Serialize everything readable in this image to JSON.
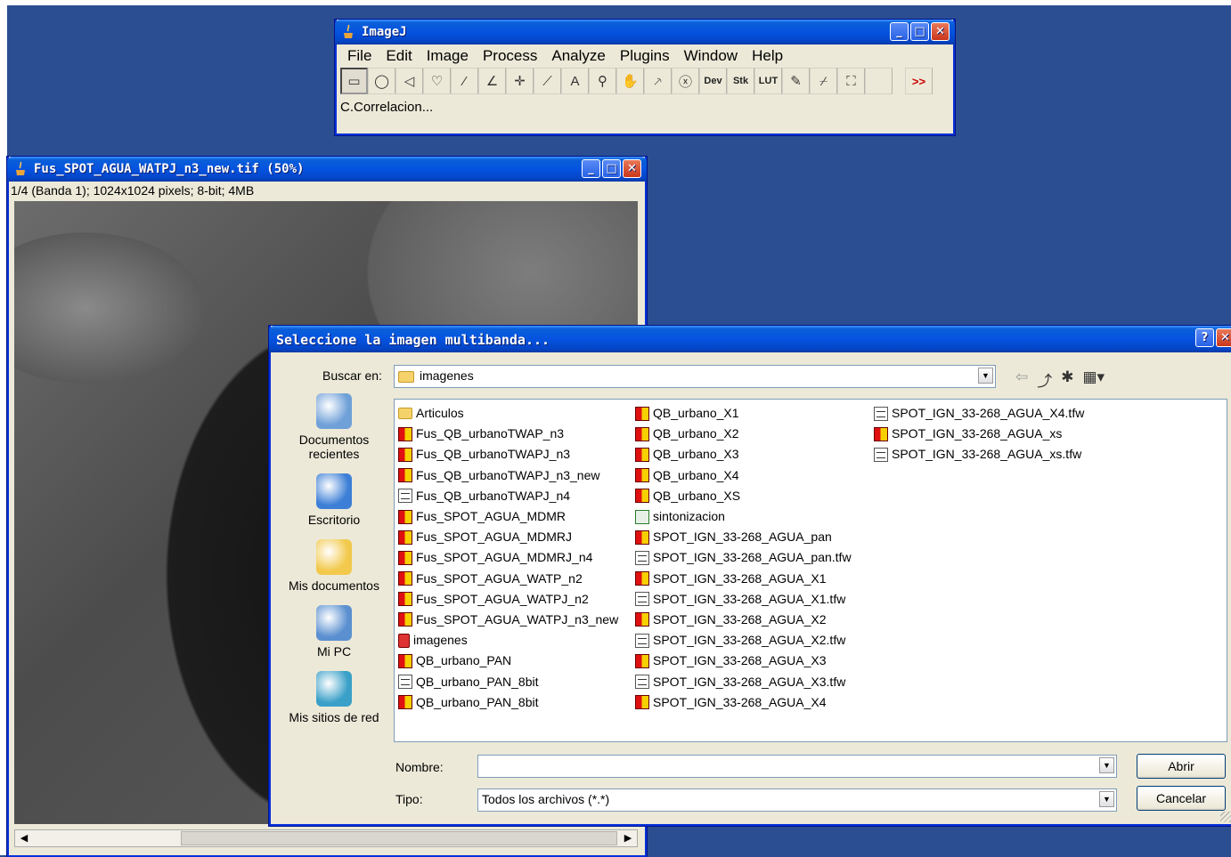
{
  "imagej": {
    "title": "ImageJ",
    "menu": [
      "File",
      "Edit",
      "Image",
      "Process",
      "Analyze",
      "Plugins",
      "Window",
      "Help"
    ],
    "tools": [
      {
        "icon": "rectangle-tool-icon",
        "glyph": "▭"
      },
      {
        "icon": "oval-tool-icon",
        "glyph": "◯"
      },
      {
        "icon": "polygon-tool-icon",
        "glyph": "◁"
      },
      {
        "icon": "freehand-tool-icon",
        "glyph": "♡"
      },
      {
        "icon": "line-tool-icon",
        "glyph": "⁄"
      },
      {
        "icon": "angle-tool-icon",
        "glyph": "∠"
      },
      {
        "icon": "point-tool-icon",
        "glyph": "✛"
      },
      {
        "icon": "wand-tool-icon",
        "glyph": "⟋"
      },
      {
        "icon": "text-tool-icon",
        "glyph": "A"
      },
      {
        "icon": "magnifier-tool-icon",
        "glyph": "⚲"
      },
      {
        "icon": "hand-tool-icon",
        "glyph": "✋"
      },
      {
        "icon": "color-picker-tool-icon",
        "glyph": "⸕"
      },
      {
        "icon": "stop-icon",
        "glyph": "ⓧ"
      },
      {
        "icon": "dev-menu-icon",
        "glyph": "Dev"
      },
      {
        "icon": "stack-menu-icon",
        "glyph": "Stk"
      },
      {
        "icon": "lut-menu-icon",
        "glyph": "LUT"
      },
      {
        "icon": "pencil-tool-icon",
        "glyph": "✎"
      },
      {
        "icon": "brush-tool-icon",
        "glyph": "⌿"
      },
      {
        "icon": "flood-fill-tool-icon",
        "glyph": "⛶"
      },
      {
        "icon": "blank-tool-icon",
        "glyph": ""
      }
    ],
    "more_tools": ">>",
    "status": "C.Correlacion..."
  },
  "image_window": {
    "title": "Fus_SPOT_AGUA_WATPJ_n3_new.tif (50%)",
    "info": "1/4 (Banda 1); 1024x1024 pixels; 8-bit; 4MB"
  },
  "dialog": {
    "title": "Seleccione la imagen multibanda...",
    "look_in_label": "Buscar en:",
    "look_in_value": "imagenes",
    "places": [
      {
        "label": "Documentos recientes",
        "icon": "recent-documents-icon",
        "color": "#6fa0d8"
      },
      {
        "label": "Escritorio",
        "icon": "desktop-icon",
        "color": "#3d7fd6"
      },
      {
        "label": "Mis documentos",
        "icon": "my-documents-icon",
        "color": "#f2c94c"
      },
      {
        "label": "Mi PC",
        "icon": "my-computer-icon",
        "color": "#5a8fd0"
      },
      {
        "label": "Mis sitios de red",
        "icon": "network-places-icon",
        "color": "#3aa0c8"
      }
    ],
    "files": [
      [
        {
          "name": "Articulos",
          "type": "fold"
        },
        {
          "name": "Fus_QB_urbanoTWAP_n3",
          "type": "img"
        },
        {
          "name": "Fus_QB_urbanoTWAPJ_n3",
          "type": "img"
        },
        {
          "name": "Fus_QB_urbanoTWAPJ_n3_new",
          "type": "img"
        },
        {
          "name": "Fus_QB_urbanoTWAPJ_n4",
          "type": "doc"
        },
        {
          "name": "Fus_SPOT_AGUA_MDMR",
          "type": "img"
        },
        {
          "name": "Fus_SPOT_AGUA_MDMRJ",
          "type": "img"
        },
        {
          "name": "Fus_SPOT_AGUA_MDMRJ_n4",
          "type": "img"
        },
        {
          "name": "Fus_SPOT_AGUA_WATP_n2",
          "type": "img"
        },
        {
          "name": "Fus_SPOT_AGUA_WATPJ_n2",
          "type": "img"
        },
        {
          "name": "Fus_SPOT_AGUA_WATPJ_n3_new",
          "type": "img"
        },
        {
          "name": "imagenes",
          "type": "shortcut"
        },
        {
          "name": "QB_urbano_PAN",
          "type": "img"
        },
        {
          "name": "QB_urbano_PAN_8bit",
          "type": "doc"
        },
        {
          "name": "QB_urbano_PAN_8bit",
          "type": "img"
        }
      ],
      [
        {
          "name": "QB_urbano_X1",
          "type": "img"
        },
        {
          "name": "QB_urbano_X2",
          "type": "img"
        },
        {
          "name": "QB_urbano_X3",
          "type": "img"
        },
        {
          "name": "QB_urbano_X4",
          "type": "img"
        },
        {
          "name": "QB_urbano_XS",
          "type": "img"
        },
        {
          "name": "sintonizacion",
          "type": "xls"
        },
        {
          "name": "SPOT_IGN_33-268_AGUA_pan",
          "type": "img"
        },
        {
          "name": "SPOT_IGN_33-268_AGUA_pan.tfw",
          "type": "doc"
        },
        {
          "name": "SPOT_IGN_33-268_AGUA_X1",
          "type": "img"
        },
        {
          "name": "SPOT_IGN_33-268_AGUA_X1.tfw",
          "type": "doc"
        },
        {
          "name": "SPOT_IGN_33-268_AGUA_X2",
          "type": "img"
        },
        {
          "name": "SPOT_IGN_33-268_AGUA_X2.tfw",
          "type": "doc"
        },
        {
          "name": "SPOT_IGN_33-268_AGUA_X3",
          "type": "img"
        },
        {
          "name": "SPOT_IGN_33-268_AGUA_X3.tfw",
          "type": "doc"
        },
        {
          "name": "SPOT_IGN_33-268_AGUA_X4",
          "type": "img"
        }
      ],
      [
        {
          "name": "SPOT_IGN_33-268_AGUA_X4.tfw",
          "type": "doc"
        },
        {
          "name": "SPOT_IGN_33-268_AGUA_xs",
          "type": "img"
        },
        {
          "name": "SPOT_IGN_33-268_AGUA_xs.tfw",
          "type": "doc"
        }
      ]
    ],
    "name_label": "Nombre:",
    "name_value": "",
    "type_label": "Tipo:",
    "type_value": "Todos los archivos (*.*)",
    "open_button": "Abrir",
    "cancel_button": "Cancelar"
  }
}
